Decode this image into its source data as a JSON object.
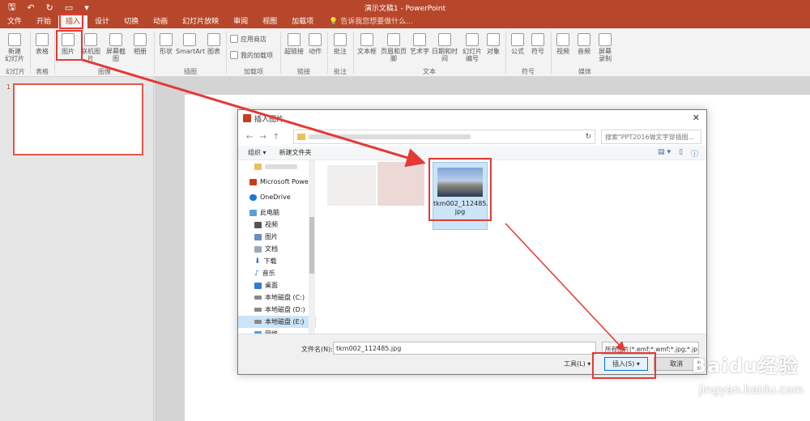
{
  "titlebar": {
    "doc_title": "演示文稿1 - PowerPoint",
    "quick_access": [
      "save-icon",
      "undo-icon",
      "redo-icon",
      "start-from-beginning-icon",
      "customize-icon"
    ]
  },
  "menu": {
    "tabs": [
      "文件",
      "开始",
      "插入",
      "设计",
      "切换",
      "动画",
      "幻灯片放映",
      "审阅",
      "视图",
      "加载项"
    ],
    "active_tab": "插入",
    "tell_me": "告诉我您想要做什么..."
  },
  "ribbon": {
    "new_slide": "新建\n幻灯片",
    "table": "表格",
    "picture": "图片",
    "online_picture": "联机图片",
    "screenshot": "屏幕截图",
    "album": "相册",
    "shapes": "形状",
    "smartart": "SmartArt",
    "chart": "图表",
    "store": "应用商店",
    "my_addins": "我的加载项",
    "hyperlink": "超链接",
    "action": "动作",
    "comment": "批注",
    "textbox": "文本框",
    "header_footer": "页眉和页脚",
    "wordart": "艺术字",
    "datetime": "日期和时间",
    "slide_number": "幻灯片\n编号",
    "object": "对象",
    "equation": "公式",
    "symbol": "符号",
    "video": "视频",
    "audio": "音频",
    "screen_record": "屏幕\n录制",
    "groups": {
      "slides": "幻灯片",
      "tables": "表格",
      "images": "图像",
      "illustrations": "插图",
      "addins": "加载项",
      "links": "链接",
      "comments": "批注",
      "text": "文本",
      "symbols": "符号",
      "media": "媒体"
    }
  },
  "thumbnails": {
    "slide_number": "1"
  },
  "dialog": {
    "title": "插入图片",
    "search_placeholder": "搜索\"PPT2016做文字穿插图...",
    "organize": "组织 ▾",
    "new_folder": "新建文件夹",
    "nav_items": [
      {
        "label": "Microsoft Powe",
        "icon": "powerpoint-icon"
      },
      {
        "label": "OneDrive",
        "icon": "onedrive-icon"
      },
      {
        "label": "此电脑",
        "icon": "computer-icon"
      },
      {
        "label": "视频",
        "icon": "video-folder-icon"
      },
      {
        "label": "图片",
        "icon": "pictures-folder-icon"
      },
      {
        "label": "文档",
        "icon": "documents-folder-icon"
      },
      {
        "label": "下载",
        "icon": "download-icon"
      },
      {
        "label": "音乐",
        "icon": "music-icon"
      },
      {
        "label": "桌面",
        "icon": "desktop-icon"
      },
      {
        "label": "本地磁盘 (C:)",
        "icon": "drive-icon"
      },
      {
        "label": "本地磁盘 (D:)",
        "icon": "drive-icon"
      },
      {
        "label": "本地磁盘 (E:)",
        "icon": "drive-icon"
      },
      {
        "label": "网络",
        "icon": "network-icon"
      }
    ],
    "selected_nav": "本地磁盘 (E:)",
    "file": {
      "name": "tkm002_112485.jpg",
      "name_line1": "tkm002_112485.",
      "name_line2": "jpg"
    },
    "filename_label": "文件名(N):",
    "filename_value": "tkm002_112485.jpg",
    "filter": "所有图片(*.emf;*.wmf;*.jpg;*.jp...",
    "tools": "工具(L)  ▾",
    "insert": "插入(S)  ▾",
    "cancel": "取消"
  },
  "watermark": {
    "brand": "Baidu经验",
    "url": "jingyan.baidu.com"
  },
  "colors": {
    "accent": "#b7472a",
    "highlight": "#e53935",
    "selection": "#cce4f7"
  }
}
